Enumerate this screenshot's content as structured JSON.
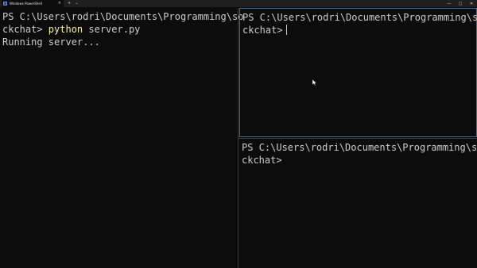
{
  "titlebar": {
    "tab_title": "Windows PowerShell",
    "tab_close": "×",
    "add_tab": "+",
    "dropdown": "⌄",
    "minimize": "—",
    "maximize": "▢",
    "close": "✕"
  },
  "panes": {
    "left": {
      "prompt_line1": "PS C:\\Users\\rodri\\Documents\\Programming\\so",
      "prompt_line2_prefix": "ckchat> ",
      "command_keyword": "python",
      "command_args": " server.py",
      "output": "Running server..."
    },
    "right_top": {
      "prompt_line1": "PS C:\\Users\\rodri\\Documents\\Programming\\so",
      "prompt_line2": "ckchat>"
    },
    "right_bottom": {
      "prompt_line1": "PS C:\\Users\\rodri\\Documents\\Programming\\so",
      "prompt_line2": "ckchat>"
    }
  },
  "colors": {
    "background": "#0c0c0c",
    "text": "#cccccc",
    "command_highlight": "#f9f1a5",
    "active_pane_border": "#3a6ea5"
  }
}
